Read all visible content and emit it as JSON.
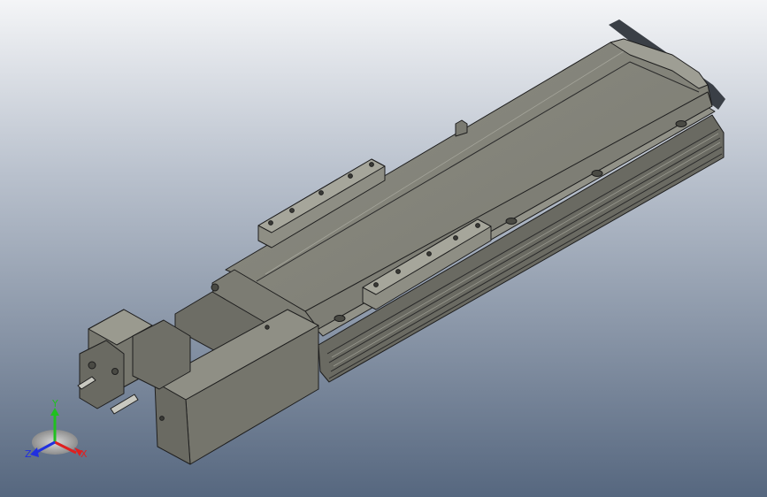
{
  "viewport": {
    "background_top": "#f3f4f6",
    "background_mid": "#a9b2c2",
    "background_bottom": "#56677f"
  },
  "model": {
    "body_color": "#8a8a80",
    "body_light": "#a2a297",
    "body_dark": "#5e5e57",
    "edge_color": "#202020"
  },
  "triad": {
    "x_label": "X",
    "y_label": "Y",
    "z_label": "Z",
    "x_color": "#e02020",
    "y_color": "#20c020",
    "z_color": "#2030e0"
  }
}
